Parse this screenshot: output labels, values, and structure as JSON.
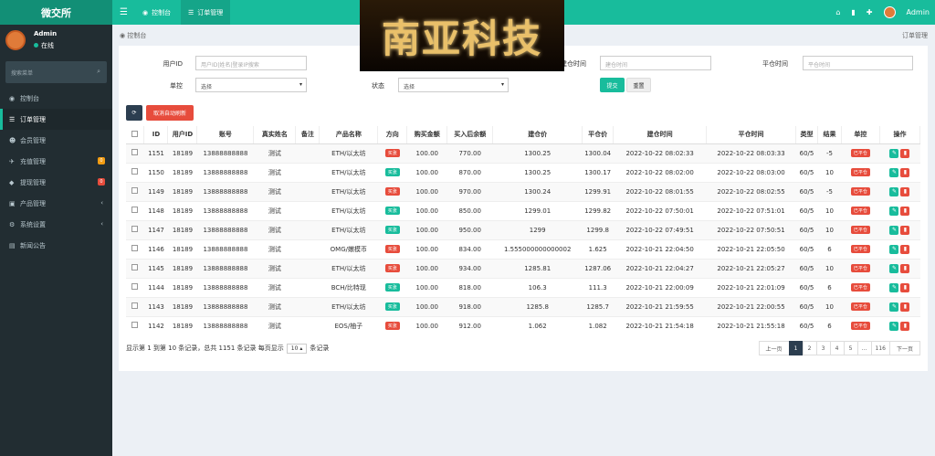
{
  "app": {
    "logo": "微交所"
  },
  "tabs": [
    {
      "label": "控制台"
    },
    {
      "label": "订单管理"
    }
  ],
  "topuser": "Admin",
  "sidebar": {
    "user": "Admin",
    "status": "在线",
    "search_placeholder": "搜索菜单",
    "items": [
      {
        "label": "控制台"
      },
      {
        "label": "订单管理"
      },
      {
        "label": "会员管理"
      },
      {
        "label": "充值管理",
        "badge": "0"
      },
      {
        "label": "提现管理",
        "badge": "0"
      },
      {
        "label": "产品管理"
      },
      {
        "label": "系统设置"
      },
      {
        "label": "新闻公告"
      }
    ]
  },
  "breadcrumb": {
    "label": "控制台",
    "right": "订单管理"
  },
  "watermark": "南亚科技",
  "filters": {
    "userid_label": "用户ID",
    "userid_placeholder": "用户ID|姓名|登录IP搜索",
    "open_time_label": "建仓时间",
    "open_time_placeholder": "建仓时间",
    "close_time_label": "平仓时间",
    "close_time_placeholder": "平仓时间",
    "control_label": "单控",
    "control_value": "选择",
    "status_label": "状态",
    "status_value": "选择",
    "submit": "提交",
    "reset": "重置"
  },
  "toolbar": {
    "cancel_refresh": "取消自动刷新"
  },
  "columns": [
    "ID",
    "用户ID",
    "账号",
    "真实姓名",
    "备注",
    "产品名称",
    "方向",
    "购买金额",
    "买入后余额",
    "建仓价",
    "平仓价",
    "建仓时间",
    "平仓时间",
    "类型",
    "结果",
    "单控",
    "操作"
  ],
  "rows": [
    [
      "1151",
      "18189",
      "13888888888",
      "测试",
      "",
      "ETH/以太坊",
      "买涨",
      "100.00",
      "770.00",
      "1300.25",
      "1300.04",
      "2022-10-22 08:02:33",
      "2022-10-22 08:03:33",
      "60/5",
      "-5",
      "已平仓"
    ],
    [
      "1150",
      "18189",
      "13888888888",
      "测试",
      "",
      "ETH/以太坊",
      "买涨",
      "100.00",
      "870.00",
      "1300.25",
      "1300.17",
      "2022-10-22 08:02:00",
      "2022-10-22 08:03:00",
      "60/5",
      "10",
      "已平仓"
    ],
    [
      "1149",
      "18189",
      "13888888888",
      "测试",
      "",
      "ETH/以太坊",
      "买涨",
      "100.00",
      "970.00",
      "1300.24",
      "1299.91",
      "2022-10-22 08:01:55",
      "2022-10-22 08:02:55",
      "60/5",
      "-5",
      "已平仓"
    ],
    [
      "1148",
      "18189",
      "13888888888",
      "测试",
      "",
      "ETH/以太坊",
      "买涨",
      "100.00",
      "850.00",
      "1299.01",
      "1299.82",
      "2022-10-22 07:50:01",
      "2022-10-22 07:51:01",
      "60/5",
      "10",
      "已平仓"
    ],
    [
      "1147",
      "18189",
      "13888888888",
      "测试",
      "",
      "ETH/以太坊",
      "买涨",
      "100.00",
      "950.00",
      "1299",
      "1299.8",
      "2022-10-22 07:49:51",
      "2022-10-22 07:50:51",
      "60/5",
      "10",
      "已平仓"
    ],
    [
      "1146",
      "18189",
      "13888888888",
      "测试",
      "",
      "OMG/嫩模币",
      "买涨",
      "100.00",
      "834.00",
      "1.555000000000002",
      "1.625",
      "2022-10-21 22:04:50",
      "2022-10-21 22:05:50",
      "60/5",
      "6",
      "已平仓"
    ],
    [
      "1145",
      "18189",
      "13888888888",
      "测试",
      "",
      "ETH/以太坊",
      "买涨",
      "100.00",
      "934.00",
      "1285.81",
      "1287.06",
      "2022-10-21 22:04:27",
      "2022-10-21 22:05:27",
      "60/5",
      "10",
      "已平仓"
    ],
    [
      "1144",
      "18189",
      "13888888888",
      "测试",
      "",
      "BCH/比特现",
      "买涨",
      "100.00",
      "818.00",
      "106.3",
      "111.3",
      "2022-10-21 22:00:09",
      "2022-10-21 22:01:09",
      "60/5",
      "6",
      "已平仓"
    ],
    [
      "1143",
      "18189",
      "13888888888",
      "测试",
      "",
      "ETH/以太坊",
      "买涨",
      "100.00",
      "918.00",
      "1285.8",
      "1285.7",
      "2022-10-21 21:59:55",
      "2022-10-21 22:00:55",
      "60/5",
      "10",
      "已平仓"
    ],
    [
      "1142",
      "18189",
      "13888888888",
      "测试",
      "",
      "EOS/柚子",
      "买涨",
      "100.00",
      "912.00",
      "1.062",
      "1.082",
      "2022-10-21 21:54:18",
      "2022-10-21 21:55:18",
      "60/5",
      "6",
      "已平仓"
    ]
  ],
  "row_direction_color": [
    "down",
    "up",
    "down",
    "up",
    "up",
    "down",
    "down",
    "up",
    "up",
    "down"
  ],
  "footer": {
    "info_a": "显示第 1 到第 10 条记录，总共 1151 条记录 每页显示",
    "page_size": "10",
    "info_b": "条记录"
  },
  "pager": [
    "上一页",
    "1",
    "2",
    "3",
    "4",
    "5",
    "...",
    "116",
    "下一页"
  ],
  "colors": {
    "accent": "#18bc9c",
    "danger": "#e74c3c",
    "sidebar": "#222d32"
  }
}
